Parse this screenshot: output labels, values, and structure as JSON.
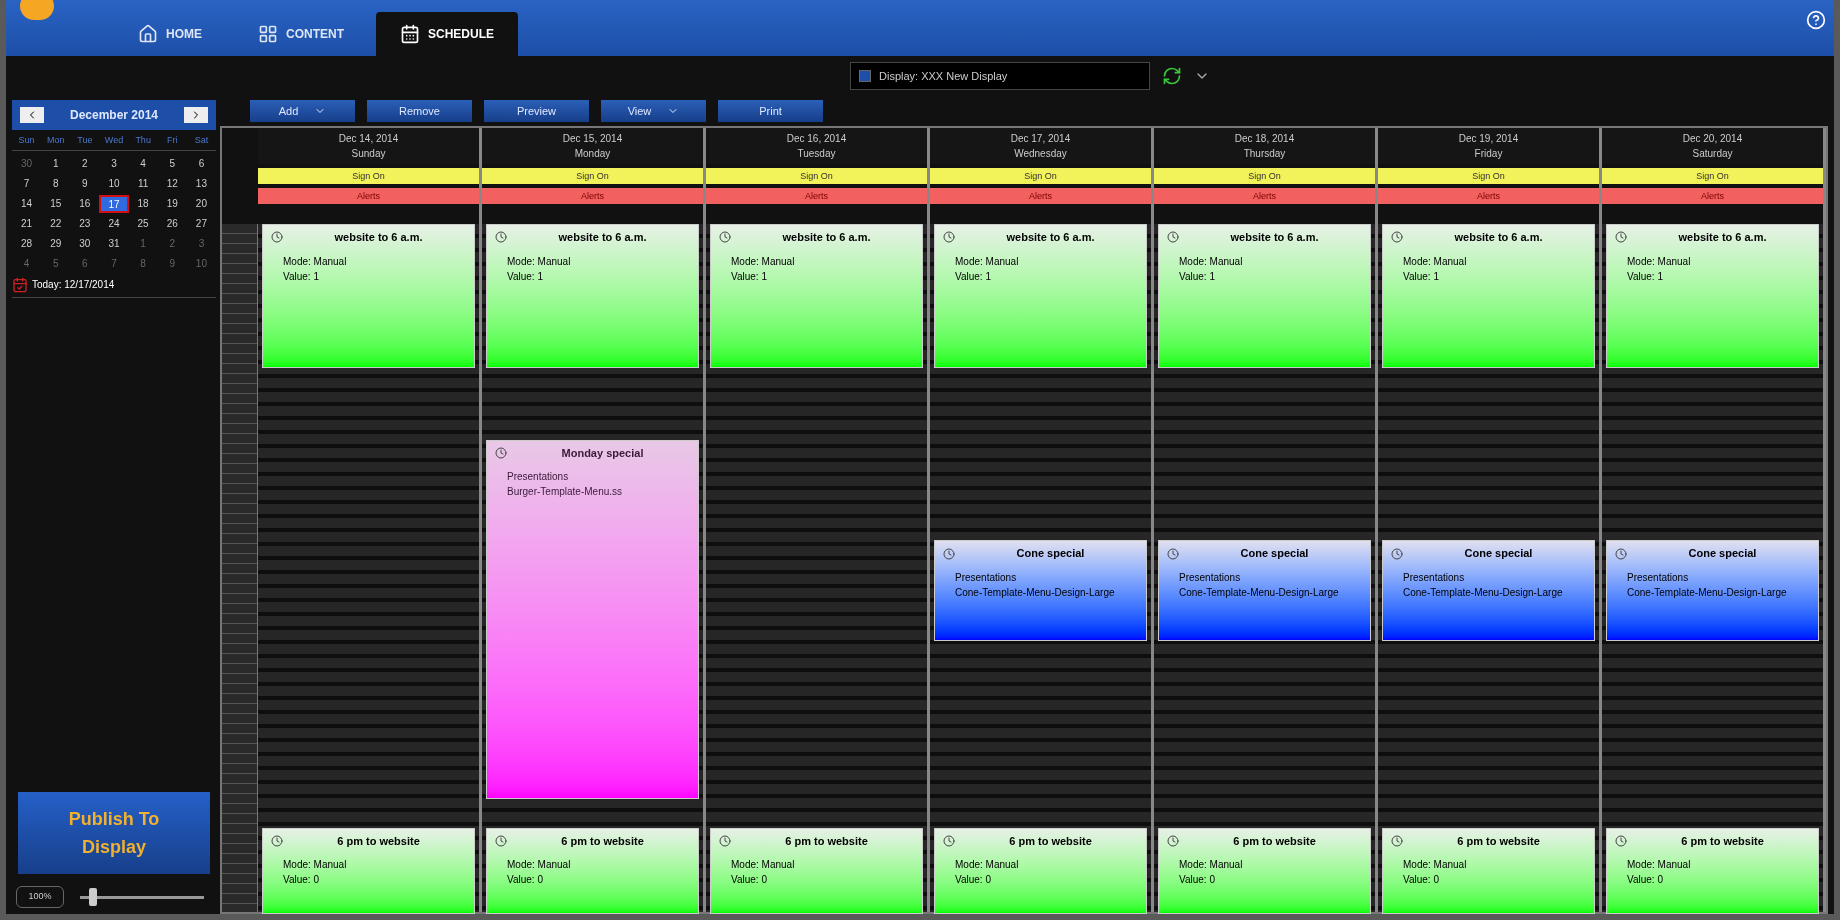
{
  "nav_tabs": [
    {
      "label": "HOME",
      "selected": false
    },
    {
      "label": "CONTENT",
      "selected": false
    },
    {
      "label": "SCHEDULE",
      "selected": true
    }
  ],
  "display_selector": {
    "value": "Display: XXX New Display"
  },
  "mini_calendar": {
    "month": "December 2014",
    "weekdays": [
      "Sun",
      "Mon",
      "Tue",
      "Wed",
      "Thu",
      "Fri",
      "Sat"
    ],
    "days": [
      {
        "label": "30",
        "muted": true,
        "selected": false
      },
      {
        "label": "1",
        "muted": false,
        "selected": false
      },
      {
        "label": "2",
        "muted": false,
        "selected": false
      },
      {
        "label": "3",
        "muted": false,
        "selected": false
      },
      {
        "label": "4",
        "muted": false,
        "selected": false
      },
      {
        "label": "5",
        "muted": false,
        "selected": false
      },
      {
        "label": "6",
        "muted": false,
        "selected": false
      },
      {
        "label": "7",
        "muted": false,
        "selected": false
      },
      {
        "label": "8",
        "muted": false,
        "selected": false
      },
      {
        "label": "9",
        "muted": false,
        "selected": false
      },
      {
        "label": "10",
        "muted": false,
        "selected": false
      },
      {
        "label": "11",
        "muted": false,
        "selected": false
      },
      {
        "label": "12",
        "muted": false,
        "selected": false
      },
      {
        "label": "13",
        "muted": false,
        "selected": false
      },
      {
        "label": "14",
        "muted": false,
        "selected": false
      },
      {
        "label": "15",
        "muted": false,
        "selected": false
      },
      {
        "label": "16",
        "muted": false,
        "selected": false
      },
      {
        "label": "17",
        "muted": false,
        "selected": true
      },
      {
        "label": "18",
        "muted": false,
        "selected": false
      },
      {
        "label": "19",
        "muted": false,
        "selected": false
      },
      {
        "label": "20",
        "muted": false,
        "selected": false
      },
      {
        "label": "21",
        "muted": false,
        "selected": false
      },
      {
        "label": "22",
        "muted": false,
        "selected": false
      },
      {
        "label": "23",
        "muted": false,
        "selected": false
      },
      {
        "label": "24",
        "muted": false,
        "selected": false
      },
      {
        "label": "25",
        "muted": false,
        "selected": false
      },
      {
        "label": "26",
        "muted": false,
        "selected": false
      },
      {
        "label": "27",
        "muted": false,
        "selected": false
      },
      {
        "label": "28",
        "muted": false,
        "selected": false
      },
      {
        "label": "29",
        "muted": false,
        "selected": false
      },
      {
        "label": "30",
        "muted": false,
        "selected": false
      },
      {
        "label": "31",
        "muted": false,
        "selected": false
      },
      {
        "label": "1",
        "muted": true,
        "selected": false
      },
      {
        "label": "2",
        "muted": true,
        "selected": false
      },
      {
        "label": "3",
        "muted": true,
        "selected": false
      },
      {
        "label": "4",
        "muted": true,
        "selected": false
      },
      {
        "label": "5",
        "muted": true,
        "selected": false
      },
      {
        "label": "6",
        "muted": true,
        "selected": false
      },
      {
        "label": "7",
        "muted": true,
        "selected": false
      },
      {
        "label": "8",
        "muted": true,
        "selected": false
      },
      {
        "label": "9",
        "muted": true,
        "selected": false
      },
      {
        "label": "10",
        "muted": true,
        "selected": false
      }
    ],
    "today": "Today: 12/17/2014"
  },
  "publish_button": {
    "label": "Publish To Display"
  },
  "zoom": {
    "value": "100%",
    "level": 0.12
  },
  "toolbar": [
    {
      "label": "Add",
      "dropdown": true
    },
    {
      "label": "Remove",
      "dropdown": false
    },
    {
      "label": "Preview",
      "dropdown": false
    },
    {
      "label": "View",
      "dropdown": true
    },
    {
      "label": "Print",
      "dropdown": false
    }
  ],
  "days": [
    {
      "date": "Dec 14, 2014",
      "weekday": "Sunday",
      "banner": "Sign On",
      "alert": "Alerts",
      "morning_event": {
        "title": "website to 6 a.m.",
        "lines": [
          "Mode: Manual",
          "Value: 1"
        ]
      },
      "evening_event": {
        "title": "6 pm to website",
        "lines": [
          "Mode: Manual",
          "Value: 0"
        ]
      }
    },
    {
      "date": "Dec 15, 2014",
      "weekday": "Monday",
      "banner": "Sign On",
      "alert": "Alerts",
      "morning_event": {
        "title": "website to 6 a.m.",
        "lines": [
          "Mode: Manual",
          "Value: 1"
        ]
      },
      "special_event": {
        "kind": "pink",
        "title": "Monday special",
        "lines": [
          "Presentations",
          "Burger-Template-Menu.ss"
        ]
      },
      "evening_event": {
        "title": "6 pm to website",
        "lines": [
          "Mode: Manual",
          "Value: 0"
        ]
      }
    },
    {
      "date": "Dec 16, 2014",
      "weekday": "Tuesday",
      "banner": "Sign On",
      "alert": "Alerts",
      "morning_event": {
        "title": "website to 6 a.m.",
        "lines": [
          "Mode: Manual",
          "Value: 1"
        ]
      },
      "evening_event": {
        "title": "6 pm to website",
        "lines": [
          "Mode: Manual",
          "Value: 0"
        ]
      }
    },
    {
      "date": "Dec 17, 2014",
      "weekday": "Wednesday",
      "banner": "Sign On",
      "alert": "Alerts",
      "morning_event": {
        "title": "website to 6 a.m.",
        "lines": [
          "Mode: Manual",
          "Value: 1"
        ]
      },
      "special_event": {
        "kind": "blue",
        "title": "Cone special",
        "lines": [
          "Presentations",
          "Cone-Template-Menu-Design-Large"
        ]
      },
      "evening_event": {
        "title": "6 pm to website",
        "lines": [
          "Mode: Manual",
          "Value: 0"
        ]
      }
    },
    {
      "date": "Dec 18, 2014",
      "weekday": "Thursday",
      "banner": "Sign On",
      "alert": "Alerts",
      "morning_event": {
        "title": "website to 6 a.m.",
        "lines": [
          "Mode: Manual",
          "Value: 1"
        ]
      },
      "special_event": {
        "kind": "blue",
        "title": "Cone special",
        "lines": [
          "Presentations",
          "Cone-Template-Menu-Design-Large"
        ]
      },
      "evening_event": {
        "title": "6 pm to website",
        "lines": [
          "Mode: Manual",
          "Value: 0"
        ]
      }
    },
    {
      "date": "Dec 19, 2014",
      "weekday": "Friday",
      "banner": "Sign On",
      "alert": "Alerts",
      "morning_event": {
        "title": "website to 6 a.m.",
        "lines": [
          "Mode: Manual",
          "Value: 1"
        ]
      },
      "special_event": {
        "kind": "blue",
        "title": "Cone special",
        "lines": [
          "Presentations",
          "Cone-Template-Menu-Design-Large"
        ]
      },
      "evening_event": {
        "title": "6 pm to website",
        "lines": [
          "Mode: Manual",
          "Value: 0"
        ]
      }
    },
    {
      "date": "Dec 20, 2014",
      "weekday": "Saturday",
      "banner": "Sign On",
      "alert": "Alerts",
      "morning_event": {
        "title": "website to 6 a.m.",
        "lines": [
          "Mode: Manual",
          "Value: 1"
        ]
      },
      "special_event": {
        "kind": "blue",
        "title": "Cone special",
        "lines": [
          "Presentations",
          "Cone-Template-Menu-Design-Large"
        ]
      },
      "evening_event": {
        "title": "6 pm to website",
        "lines": [
          "Mode: Manual",
          "Value: 0"
        ]
      }
    }
  ]
}
